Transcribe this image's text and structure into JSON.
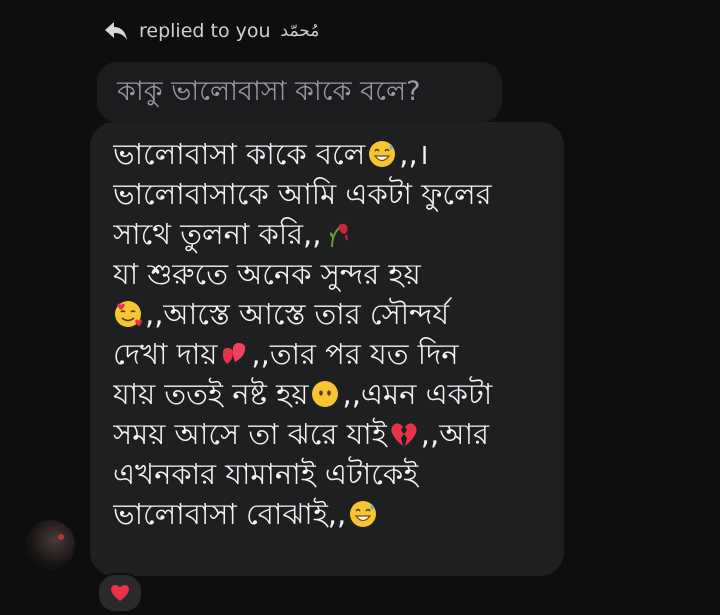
{
  "reply_header": {
    "text": "replied to you",
    "name": "مُحمّد"
  },
  "quoted_message": {
    "text": "কাকু ভালোবাসা কাকে বলে?"
  },
  "message": {
    "lines": [
      "ভালোবাসা কাকে বলে",
      ",,।",
      "ভালোবাসাকে আমি একটা ফুলের",
      "সাথে তুলনা করি,,",
      "যা শুরুতে অনেক সুন্দর হয়",
      ",,আস্তে আস্তে তার সৌন্দর্য",
      "দেখা দায়",
      ",,তার পর যত দিন",
      "যায় ততই নষ্ট হয়",
      ",,এমন একটা",
      "সময় আসে তা ঝরে যাই",
      ",,আর",
      "এখনকার যামানাই এটাকেই",
      "ভালোবাসা বোঝাই,,"
    ],
    "emoji": {
      "sweat_smile": "grinning-face-with-sweat-icon",
      "wilted_flower": "wilted-flower-icon",
      "hearts_face": "smiling-face-with-hearts-icon",
      "two_hearts": "two-hearts-icon",
      "no_mouth": "face-without-mouth-icon",
      "broken_heart": "broken-heart-icon"
    }
  },
  "reaction": {
    "emoji": "red-heart-icon"
  },
  "colors": {
    "background": "#0e0e0f",
    "bubble": "#1e1f21",
    "text": "#f3f3f5",
    "quoted_text": "#9a9aa0",
    "heart": "#e8324a"
  }
}
